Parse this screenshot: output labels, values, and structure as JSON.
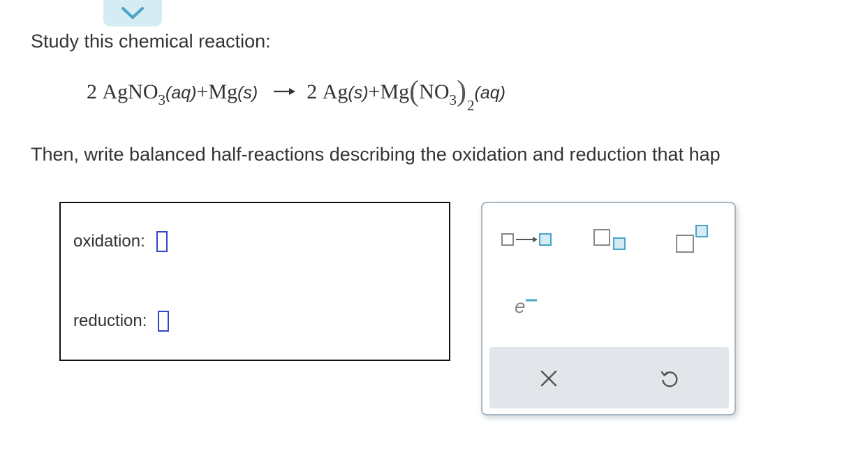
{
  "header": {
    "collapse_icon": "chevron-down-icon"
  },
  "prompt": {
    "line1": "Study this chemical reaction:",
    "line2": "Then, write balanced half-reactions describing the oxidation and reduction that hap"
  },
  "equation": {
    "r1_coef": "2",
    "r1_formula": "AgNO",
    "r1_sub": "3",
    "r1_phase": "(aq)",
    "plus1": "+",
    "r2_formula": "Mg",
    "r2_phase": "(s)",
    "arrow": "→",
    "p1_coef": "2",
    "p1_formula": "Ag",
    "p1_phase": "(s)",
    "plus2": "+",
    "p2_formula": "Mg",
    "p2_paren_open": "(",
    "p2_inner": "NO",
    "p2_inner_sub": "3",
    "p2_paren_close": ")",
    "p2_sub": "2",
    "p2_phase": "(aq)"
  },
  "answer": {
    "oxidation_label": "oxidation:",
    "reduction_label": "reduction:"
  },
  "palette": {
    "electron_symbol": "e",
    "buttons": [
      "reaction-arrow",
      "subscript",
      "superscript",
      "electron",
      "clear",
      "undo"
    ]
  },
  "colors": {
    "accent": "#4aa3c8",
    "slot_border": "#3348c8",
    "tab_bg": "#d6ecf4",
    "palette_bar": "#e2e6ea"
  }
}
